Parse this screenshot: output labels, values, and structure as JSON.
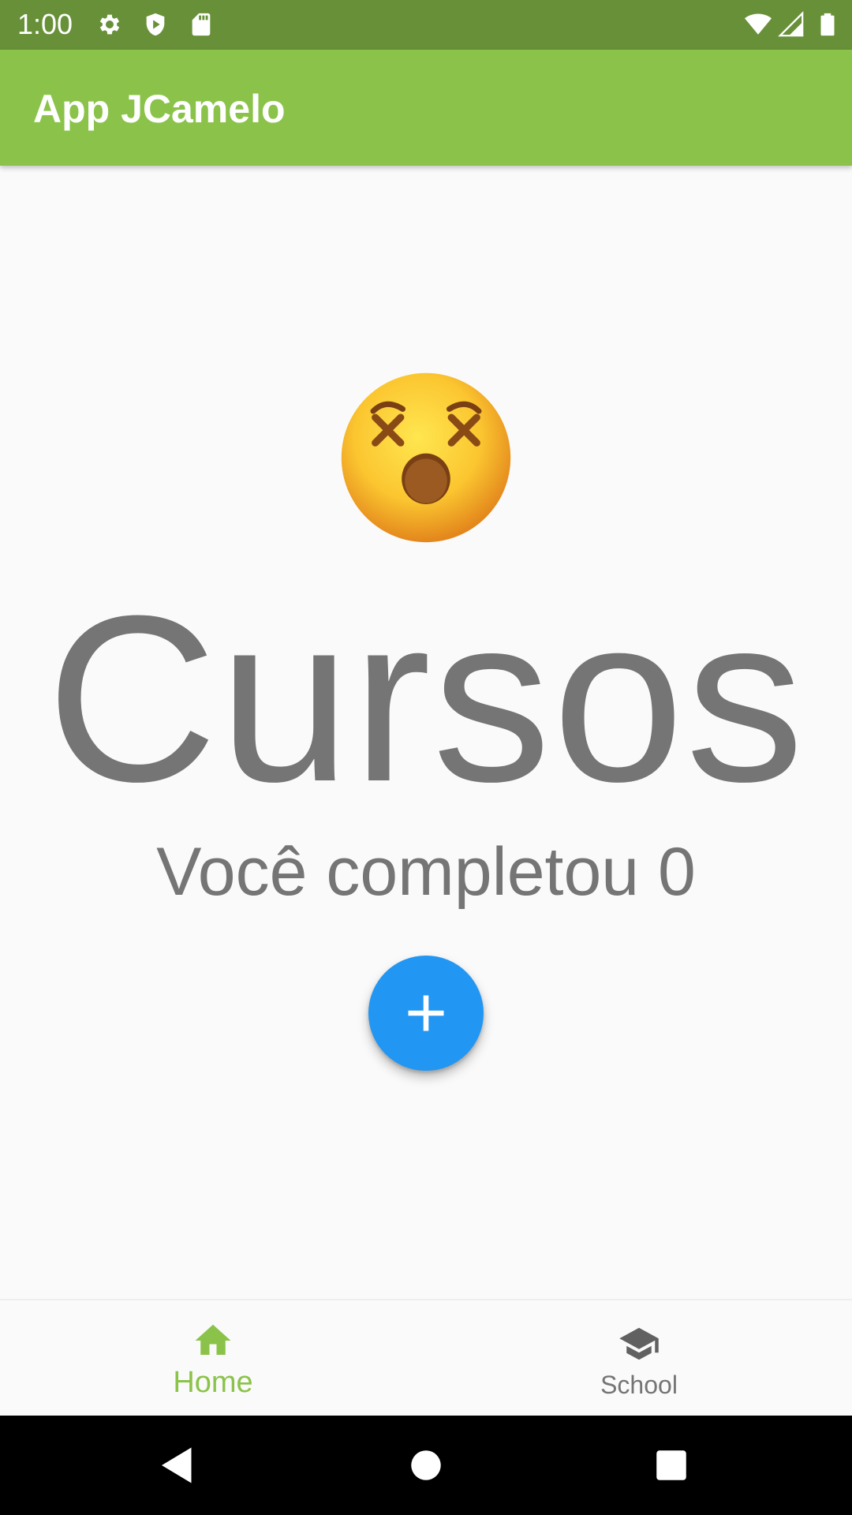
{
  "status_bar": {
    "time": "1:00",
    "icons_left": [
      "settings-icon",
      "shield-play-icon",
      "sd-card-icon"
    ],
    "icons_right": [
      "wifi-icon",
      "cell-signal-icon",
      "battery-icon"
    ]
  },
  "app_bar": {
    "title": "App JCamelo",
    "color": "#8bc34a"
  },
  "content": {
    "emoji": "dizzy-face-emoji",
    "heading": "Cursos",
    "subtitle": "Você completou 0",
    "fab_icon": "plus-icon",
    "fab_color": "#2196f3"
  },
  "bottom_nav": {
    "items": [
      {
        "label": "Home",
        "icon": "home-icon",
        "active": true,
        "color": "#8bc34a"
      },
      {
        "label": "School",
        "icon": "school-icon",
        "active": false,
        "color": "#757575"
      }
    ]
  },
  "system_nav": {
    "buttons": [
      "back-icon",
      "home-circle-icon",
      "recents-icon"
    ]
  }
}
